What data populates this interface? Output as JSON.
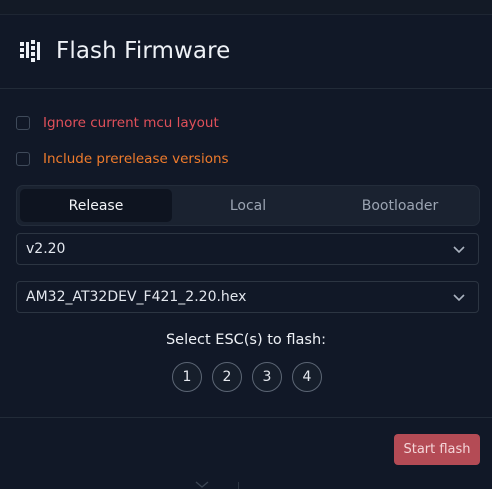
{
  "colors": {
    "background": "#111827",
    "warning_red": "#e0505a",
    "warning_orange": "#ef7b2c",
    "accent_button": "#b44b55"
  },
  "header": {
    "icon": "grid-bars-icon",
    "title": "Flash Firmware"
  },
  "options": [
    {
      "label": "Ignore current mcu layout",
      "checked": false
    },
    {
      "label": "Include prerelease versions",
      "checked": false
    }
  ],
  "tabs": [
    {
      "label": "Release",
      "active": true
    },
    {
      "label": "Local",
      "active": false
    },
    {
      "label": "Bootloader",
      "active": false
    }
  ],
  "version_select": {
    "value": "v2.20",
    "icon": "chevron-down-icon"
  },
  "file_select": {
    "value": "AM32_AT32DEV_F421_2.20.hex",
    "icon": "chevron-down-icon"
  },
  "esc": {
    "label": "Select ESC(s) to flash:",
    "buttons": [
      "1",
      "2",
      "3",
      "4"
    ]
  },
  "footer": {
    "start_label": "Start flash"
  }
}
